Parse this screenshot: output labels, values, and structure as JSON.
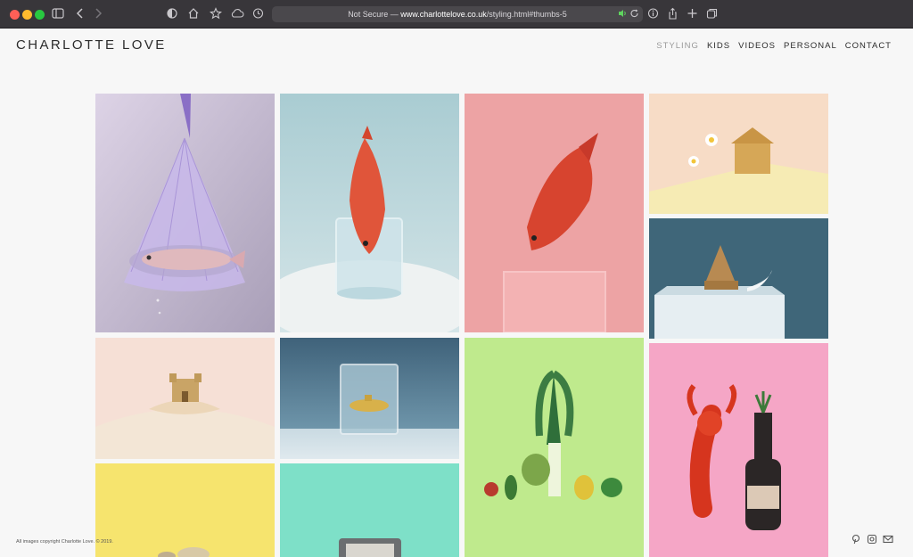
{
  "browser": {
    "url_prefix": "Not Secure — ",
    "url_host": "www.charlottelove.co.uk",
    "url_path": "/styling.html#thumbs-5"
  },
  "site": {
    "logo": "CHARLOTTE LOVE",
    "nav": [
      "STYLING",
      "KIDS",
      "VIDEOS",
      "PERSONAL",
      "CONTACT"
    ],
    "active_nav": "STYLING"
  },
  "footer": {
    "copyright": "All images copyright Charlotte Love. © 2019."
  },
  "icons": [
    "sidebar-icon",
    "back-icon",
    "forward-icon",
    "shield-icon",
    "home-icon",
    "star-icon",
    "cloud-icon",
    "history-icon",
    "speaker-icon",
    "reload-icon",
    "info-icon",
    "share-icon",
    "new-tab-icon",
    "tabs-icon",
    "pinterest-icon",
    "instagram-icon",
    "mail-icon"
  ]
}
